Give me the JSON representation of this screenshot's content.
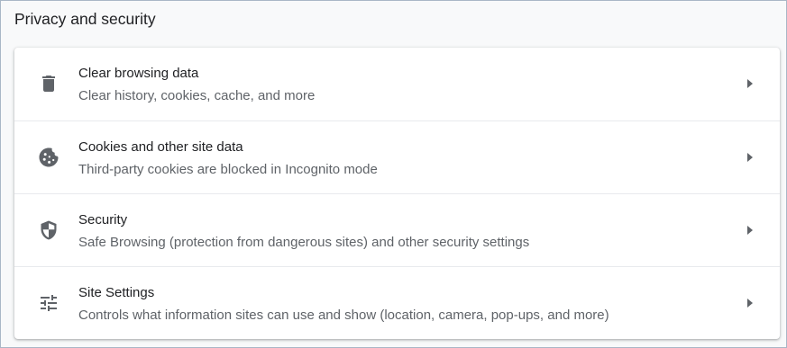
{
  "section": {
    "title": "Privacy and security"
  },
  "items": [
    {
      "icon": "trash-icon",
      "title": "Clear browsing data",
      "subtitle": "Clear history, cookies, cache, and more"
    },
    {
      "icon": "cookie-icon",
      "title": "Cookies and other site data",
      "subtitle": "Third-party cookies are blocked in Incognito mode"
    },
    {
      "icon": "shield-icon",
      "title": "Security",
      "subtitle": "Safe Browsing (protection from dangerous sites) and other security settings"
    },
    {
      "icon": "tune-icon",
      "title": "Site Settings",
      "subtitle": "Controls what information sites can use and show (location, camera, pop-ups, and more)"
    }
  ],
  "colors": {
    "background": "#f8f9fa",
    "card": "#ffffff",
    "title_text": "#202124",
    "secondary_text": "#5f6368",
    "icon": "#5f6368",
    "divider": "#e8eaed"
  }
}
